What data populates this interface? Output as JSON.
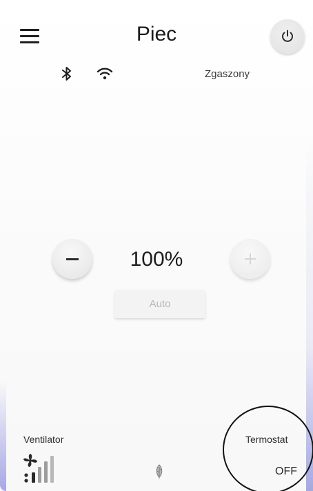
{
  "header": {
    "title": "Piec",
    "menu_icon": "hamburger-menu-icon",
    "power_icon": "power-icon"
  },
  "status_bar": {
    "bluetooth_icon": "bluetooth-icon",
    "wifi_icon": "wifi-icon",
    "status_text": "Zgaszony"
  },
  "control": {
    "value_text": "100%",
    "minus_icon": "minus-icon",
    "plus_icon": "plus-icon",
    "auto_label": "Auto"
  },
  "footer": {
    "ventilator_label": "Ventilator",
    "fan_icon": "fan-signal-icon",
    "leaf_icon": "leaf-icon",
    "thermostat_label": "Termostat",
    "thermostat_value": "OFF"
  },
  "colors": {
    "text": "#1c1c1c",
    "disabled": "#b7b7b7",
    "accent_edge": "#a8a7e6"
  }
}
